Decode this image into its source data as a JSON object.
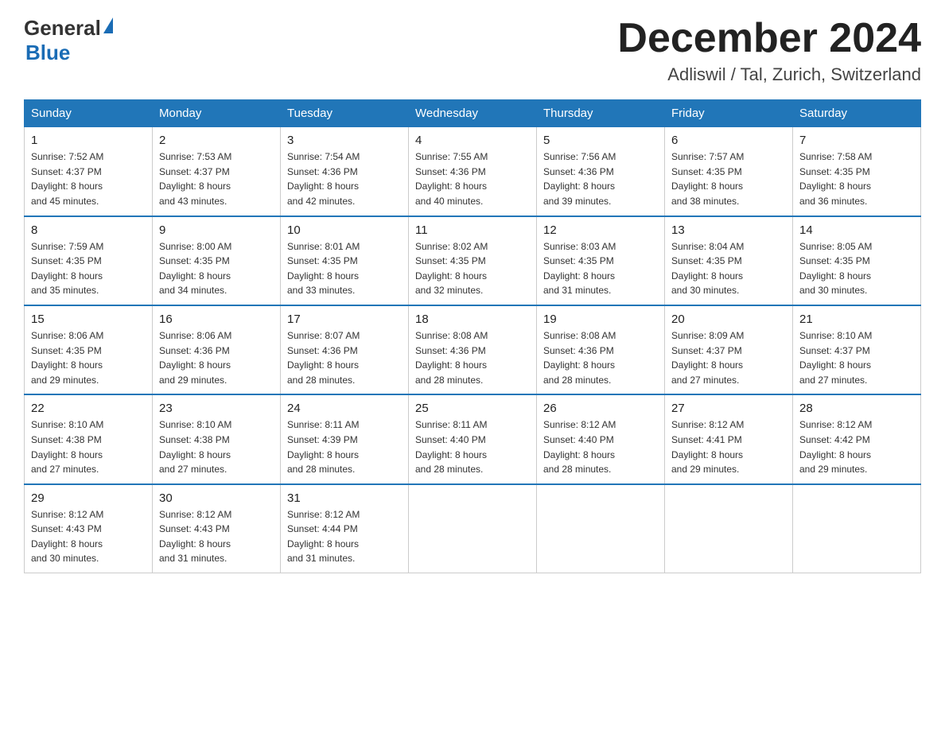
{
  "header": {
    "logo_general": "General",
    "logo_blue": "Blue",
    "title": "December 2024",
    "subtitle": "Adliswil / Tal, Zurich, Switzerland"
  },
  "weekdays": [
    "Sunday",
    "Monday",
    "Tuesday",
    "Wednesday",
    "Thursday",
    "Friday",
    "Saturday"
  ],
  "weeks": [
    [
      {
        "day": "1",
        "sunrise": "7:52 AM",
        "sunset": "4:37 PM",
        "daylight": "8 hours and 45 minutes."
      },
      {
        "day": "2",
        "sunrise": "7:53 AM",
        "sunset": "4:37 PM",
        "daylight": "8 hours and 43 minutes."
      },
      {
        "day": "3",
        "sunrise": "7:54 AM",
        "sunset": "4:36 PM",
        "daylight": "8 hours and 42 minutes."
      },
      {
        "day": "4",
        "sunrise": "7:55 AM",
        "sunset": "4:36 PM",
        "daylight": "8 hours and 40 minutes."
      },
      {
        "day": "5",
        "sunrise": "7:56 AM",
        "sunset": "4:36 PM",
        "daylight": "8 hours and 39 minutes."
      },
      {
        "day": "6",
        "sunrise": "7:57 AM",
        "sunset": "4:35 PM",
        "daylight": "8 hours and 38 minutes."
      },
      {
        "day": "7",
        "sunrise": "7:58 AM",
        "sunset": "4:35 PM",
        "daylight": "8 hours and 36 minutes."
      }
    ],
    [
      {
        "day": "8",
        "sunrise": "7:59 AM",
        "sunset": "4:35 PM",
        "daylight": "8 hours and 35 minutes."
      },
      {
        "day": "9",
        "sunrise": "8:00 AM",
        "sunset": "4:35 PM",
        "daylight": "8 hours and 34 minutes."
      },
      {
        "day": "10",
        "sunrise": "8:01 AM",
        "sunset": "4:35 PM",
        "daylight": "8 hours and 33 minutes."
      },
      {
        "day": "11",
        "sunrise": "8:02 AM",
        "sunset": "4:35 PM",
        "daylight": "8 hours and 32 minutes."
      },
      {
        "day": "12",
        "sunrise": "8:03 AM",
        "sunset": "4:35 PM",
        "daylight": "8 hours and 31 minutes."
      },
      {
        "day": "13",
        "sunrise": "8:04 AM",
        "sunset": "4:35 PM",
        "daylight": "8 hours and 30 minutes."
      },
      {
        "day": "14",
        "sunrise": "8:05 AM",
        "sunset": "4:35 PM",
        "daylight": "8 hours and 30 minutes."
      }
    ],
    [
      {
        "day": "15",
        "sunrise": "8:06 AM",
        "sunset": "4:35 PM",
        "daylight": "8 hours and 29 minutes."
      },
      {
        "day": "16",
        "sunrise": "8:06 AM",
        "sunset": "4:36 PM",
        "daylight": "8 hours and 29 minutes."
      },
      {
        "day": "17",
        "sunrise": "8:07 AM",
        "sunset": "4:36 PM",
        "daylight": "8 hours and 28 minutes."
      },
      {
        "day": "18",
        "sunrise": "8:08 AM",
        "sunset": "4:36 PM",
        "daylight": "8 hours and 28 minutes."
      },
      {
        "day": "19",
        "sunrise": "8:08 AM",
        "sunset": "4:36 PM",
        "daylight": "8 hours and 28 minutes."
      },
      {
        "day": "20",
        "sunrise": "8:09 AM",
        "sunset": "4:37 PM",
        "daylight": "8 hours and 27 minutes."
      },
      {
        "day": "21",
        "sunrise": "8:10 AM",
        "sunset": "4:37 PM",
        "daylight": "8 hours and 27 minutes."
      }
    ],
    [
      {
        "day": "22",
        "sunrise": "8:10 AM",
        "sunset": "4:38 PM",
        "daylight": "8 hours and 27 minutes."
      },
      {
        "day": "23",
        "sunrise": "8:10 AM",
        "sunset": "4:38 PM",
        "daylight": "8 hours and 27 minutes."
      },
      {
        "day": "24",
        "sunrise": "8:11 AM",
        "sunset": "4:39 PM",
        "daylight": "8 hours and 28 minutes."
      },
      {
        "day": "25",
        "sunrise": "8:11 AM",
        "sunset": "4:40 PM",
        "daylight": "8 hours and 28 minutes."
      },
      {
        "day": "26",
        "sunrise": "8:12 AM",
        "sunset": "4:40 PM",
        "daylight": "8 hours and 28 minutes."
      },
      {
        "day": "27",
        "sunrise": "8:12 AM",
        "sunset": "4:41 PM",
        "daylight": "8 hours and 29 minutes."
      },
      {
        "day": "28",
        "sunrise": "8:12 AM",
        "sunset": "4:42 PM",
        "daylight": "8 hours and 29 minutes."
      }
    ],
    [
      {
        "day": "29",
        "sunrise": "8:12 AM",
        "sunset": "4:43 PM",
        "daylight": "8 hours and 30 minutes."
      },
      {
        "day": "30",
        "sunrise": "8:12 AM",
        "sunset": "4:43 PM",
        "daylight": "8 hours and 31 minutes."
      },
      {
        "day": "31",
        "sunrise": "8:12 AM",
        "sunset": "4:44 PM",
        "daylight": "8 hours and 31 minutes."
      },
      null,
      null,
      null,
      null
    ]
  ],
  "labels": {
    "sunrise": "Sunrise: ",
    "sunset": "Sunset: ",
    "daylight": "Daylight: "
  }
}
